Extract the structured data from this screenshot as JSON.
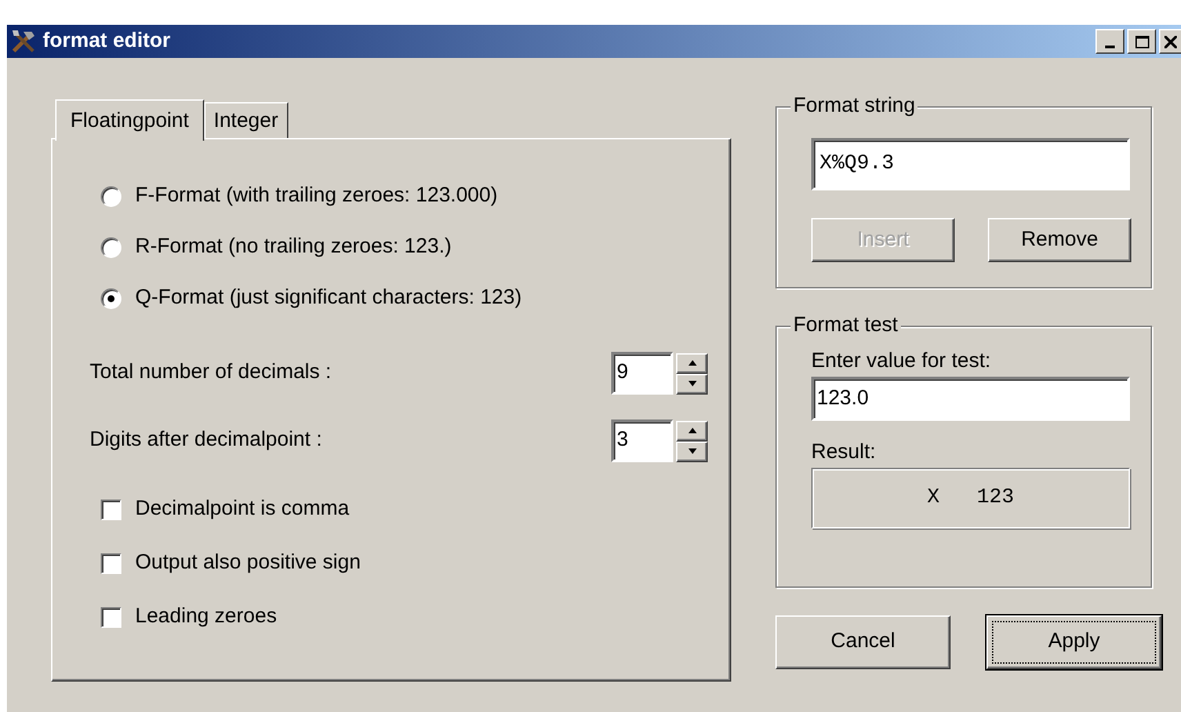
{
  "window": {
    "title": "format editor"
  },
  "tabs": [
    {
      "label": "Floatingpoint",
      "selected": true
    },
    {
      "label": "Integer",
      "selected": false
    }
  ],
  "format_options": [
    {
      "label": "F-Format (with trailing zeroes: 123.000)",
      "selected": false
    },
    {
      "label": "R-Format (no trailing zeroes: 123.)",
      "selected": false
    },
    {
      "label": "Q-Format (just significant characters: 123)",
      "selected": true
    }
  ],
  "spinners": [
    {
      "label": "Total number of decimals :",
      "value": "9"
    },
    {
      "label": "Digits after decimalpoint :",
      "value": "3"
    }
  ],
  "checkboxes": [
    {
      "label": "Decimalpoint is comma",
      "checked": false
    },
    {
      "label": "Output also positive sign",
      "checked": false
    },
    {
      "label": "Leading zeroes",
      "checked": false
    }
  ],
  "format_string": {
    "title": "Format string",
    "value": "X%Q9.3",
    "buttons": [
      {
        "label": "Insert",
        "disabled": true
      },
      {
        "label": "Remove",
        "disabled": false
      }
    ]
  },
  "format_test": {
    "title": "Format test",
    "input_label": "Enter value for test:",
    "value": "123.0",
    "result_label": "Result:",
    "result": "X   123"
  },
  "buttons": [
    {
      "label": "Cancel",
      "default": false
    },
    {
      "label": "Apply",
      "default": true
    }
  ]
}
